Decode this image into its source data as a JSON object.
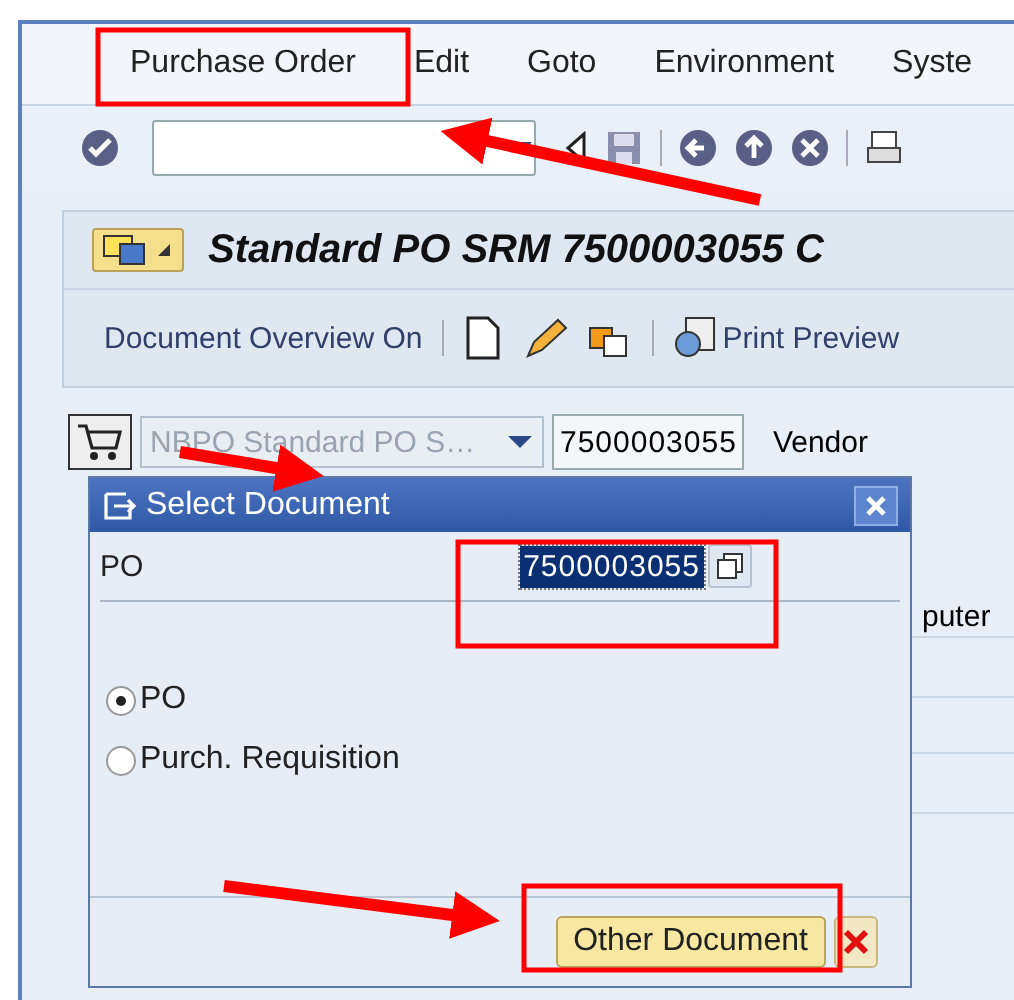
{
  "menu": [
    {
      "label": "Purchase Order"
    },
    {
      "label": "Edit"
    },
    {
      "label": "Goto"
    },
    {
      "label": "Environment"
    },
    {
      "label": "Syste"
    }
  ],
  "title": "Standard PO SRM 7500003055 C",
  "app_toolbar": {
    "overview_button": "Document Overview On",
    "print_preview_button": "Print Preview"
  },
  "header": {
    "document_type": "NBPO Standard PO S…",
    "number": "7500003055",
    "vendor_label": "Vendor"
  },
  "background_text": "puter",
  "dialog": {
    "title": "Select Document",
    "field_label": "PO",
    "field_value": "7500003055",
    "options": [
      {
        "label": "PO",
        "selected": true
      },
      {
        "label": "Purch. Requisition",
        "selected": false
      }
    ],
    "primary_button": "Other Document"
  }
}
